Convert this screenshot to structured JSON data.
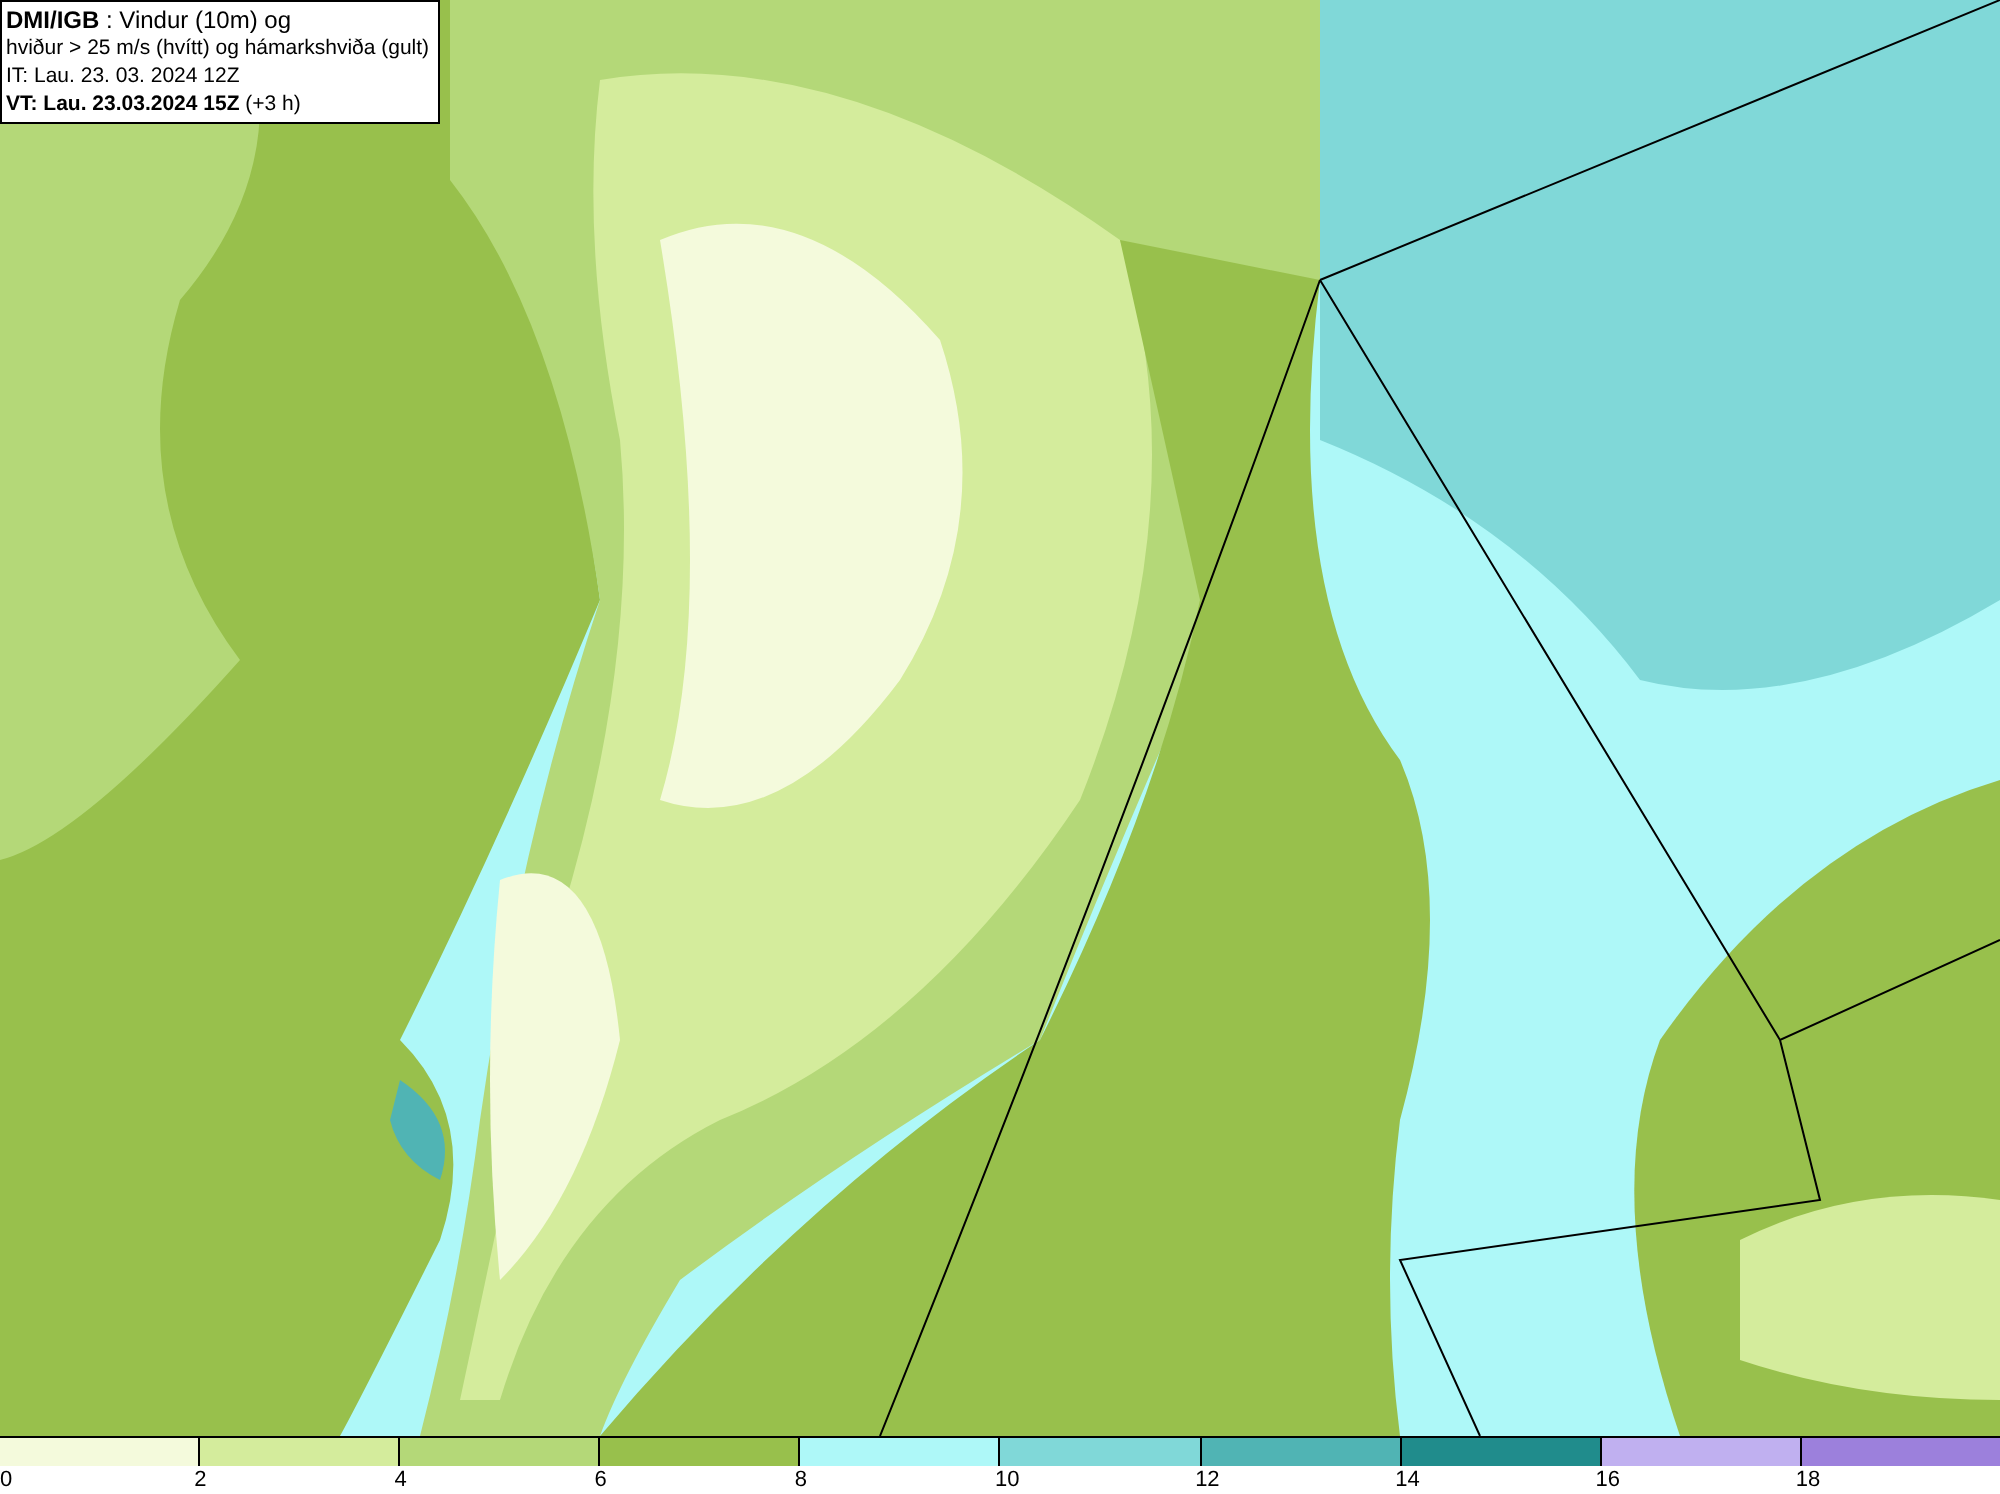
{
  "title_box": {
    "lines": [
      "**DMI/IGB** : Vindur (10m) og",
      "hviður > 25 m/s (hvítt) og hámarkshviða (gult)",
      "IT: Lau. 23. 03. 2024 12Z",
      "**VT: Lau. 23.03.2024 15Z** (+3 h)"
    ]
  },
  "legend": {
    "segments": [
      {
        "color": "#f4fadc",
        "tick": "0"
      },
      {
        "color": "#d4ec9c",
        "tick": "2"
      },
      {
        "color": "#b4d878",
        "tick": "4"
      },
      {
        "color": "#98c04c",
        "tick": "6"
      },
      {
        "color": "#aef8f8",
        "tick": "8"
      },
      {
        "color": "#80d8d8",
        "tick": "10"
      },
      {
        "color": "#50b4b4",
        "tick": "12"
      },
      {
        "color": "#208c8c",
        "tick": "14"
      },
      {
        "color": "#c0b0f0",
        "tick": "16"
      },
      {
        "color": "#9c80dc",
        "tick": "18"
      }
    ]
  }
}
